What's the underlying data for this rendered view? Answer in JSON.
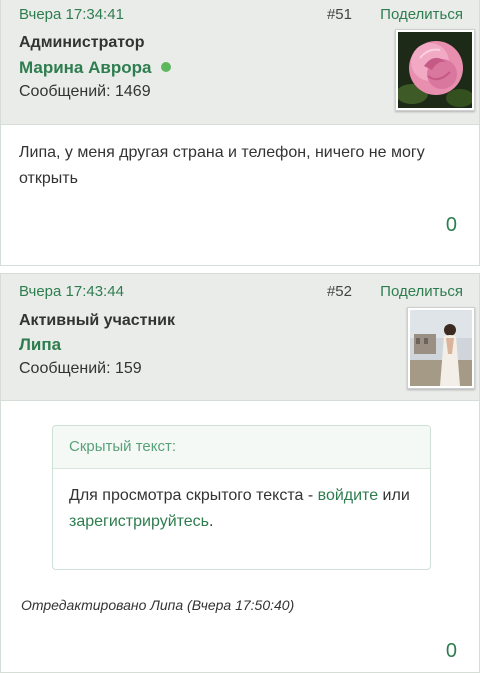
{
  "posts": [
    {
      "date": "Вчера 17:34:41",
      "number": "#51",
      "share_label": "Поделиться",
      "role": "Администратор",
      "author": "Марина Аврора",
      "online": true,
      "messages": "Сообщений: 1469",
      "avatar_icon": "rose-avatar",
      "text": "Липа, у меня другая страна и телефон, ничего не могу открыть",
      "likes": "0"
    },
    {
      "date": "Вчера 17:43:44",
      "number": "#52",
      "share_label": "Поделиться",
      "role": "Активный участник",
      "author": "Липа",
      "messages": "Сообщений: 159",
      "avatar_icon": "woman-photo-avatar",
      "hidden": {
        "title": "Скрытый текст:",
        "text_before": "Для просмотра скрытого текста - ",
        "login_link": "войдите",
        "text_middle": " или ",
        "register_link": "зарегистрируйтесь",
        "text_after": "."
      },
      "edited": "Отредактировано Липа (Вчера 17:50:40)",
      "likes": "0"
    }
  ],
  "colors": {
    "accent": "#2e7d4f",
    "header_bg": "#eaecea",
    "online": "#5cb85c"
  }
}
